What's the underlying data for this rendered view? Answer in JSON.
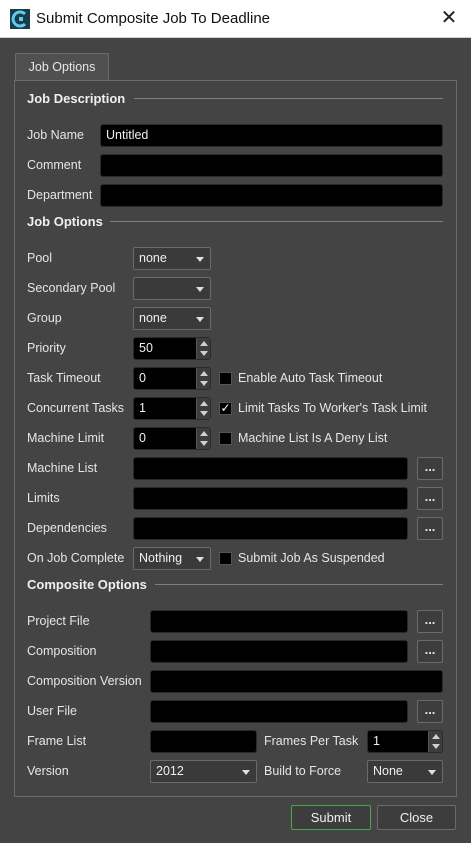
{
  "window": {
    "title": "Submit Composite Job To Deadline"
  },
  "tab": {
    "label": "Job Options"
  },
  "job_description": {
    "heading": "Job Description",
    "job_name_label": "Job Name",
    "job_name_value": "Untitled",
    "comment_label": "Comment",
    "comment_value": "",
    "department_label": "Department",
    "department_value": ""
  },
  "job_options": {
    "heading": "Job Options",
    "pool_label": "Pool",
    "pool_value": "none",
    "secondary_pool_label": "Secondary Pool",
    "secondary_pool_value": "",
    "group_label": "Group",
    "group_value": "none",
    "priority_label": "Priority",
    "priority_value": "50",
    "task_timeout_label": "Task Timeout",
    "task_timeout_value": "0",
    "auto_timeout_label": "Enable Auto Task Timeout",
    "auto_timeout_checked": false,
    "concurrent_tasks_label": "Concurrent Tasks",
    "concurrent_tasks_value": "1",
    "limit_tasks_label": "Limit Tasks To Worker's Task Limit",
    "limit_tasks_checked": true,
    "machine_limit_label": "Machine Limit",
    "machine_limit_value": "0",
    "deny_list_label": "Machine List Is A Deny List",
    "deny_list_checked": false,
    "machine_list_label": "Machine List",
    "machine_list_value": "",
    "limits_label": "Limits",
    "limits_value": "",
    "dependencies_label": "Dependencies",
    "dependencies_value": "",
    "on_complete_label": "On Job Complete",
    "on_complete_value": "Nothing",
    "suspended_label": "Submit Job As Suspended",
    "suspended_checked": false,
    "browse_label": "..."
  },
  "composite_options": {
    "heading": "Composite Options",
    "project_file_label": "Project File",
    "project_file_value": "",
    "composition_label": "Composition",
    "composition_value": "",
    "composition_version_label": "Composition Version",
    "composition_version_value": "",
    "user_file_label": "User File",
    "user_file_value": "",
    "frame_list_label": "Frame List",
    "frame_list_value": "",
    "frames_per_task_label": "Frames Per Task",
    "frames_per_task_value": "1",
    "version_label": "Version",
    "version_value": "2012",
    "build_label": "Build to Force",
    "build_value": "None"
  },
  "buttons": {
    "submit": "Submit",
    "close": "Close"
  },
  "colors": {
    "accent_green": "#4aa84a",
    "background": "#444444",
    "field": "#000000"
  },
  "icons": {
    "app": "composite-app-icon",
    "close": "close-icon",
    "check": "checkmark-icon"
  }
}
